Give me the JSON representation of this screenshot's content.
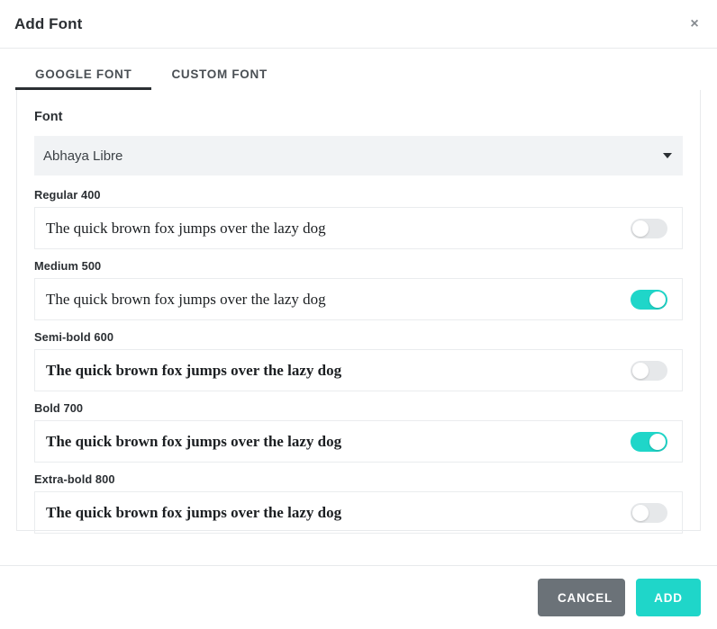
{
  "header": {
    "title": "Add Font",
    "close_label": "×"
  },
  "tabs": [
    {
      "label": "GOOGLE FONT",
      "active": true
    },
    {
      "label": "CUSTOM FONT",
      "active": false
    }
  ],
  "form": {
    "font_label": "Font",
    "font_select": {
      "value": "Abhaya Libre",
      "caret_icon": "chevron-down-icon"
    },
    "weights": [
      {
        "label": "Regular 400",
        "sample": "The quick brown fox jumps over the lazy dog",
        "enabled": false,
        "css_weight": "w400"
      },
      {
        "label": "Medium 500",
        "sample": "The quick brown fox jumps over the lazy dog",
        "enabled": true,
        "css_weight": "w500"
      },
      {
        "label": "Semi-bold 600",
        "sample": "The quick brown fox jumps over the lazy dog",
        "enabled": false,
        "css_weight": "w600"
      },
      {
        "label": "Bold 700",
        "sample": "The quick brown fox jumps over the lazy dog",
        "enabled": true,
        "css_weight": "w700"
      },
      {
        "label": "Extra-bold 800",
        "sample": "The quick brown fox jumps over the lazy dog",
        "enabled": false,
        "css_weight": "w800"
      }
    ]
  },
  "footer": {
    "cancel_label": "CANCEL",
    "add_label": "ADD"
  },
  "colors": {
    "accent_teal": "#1fd6c9",
    "cancel_gray": "#6b7278",
    "text_dark": "#2b2f33",
    "select_bg": "#f1f3f5",
    "border": "#e8eaec",
    "toggle_off": "#e6e8ea"
  }
}
